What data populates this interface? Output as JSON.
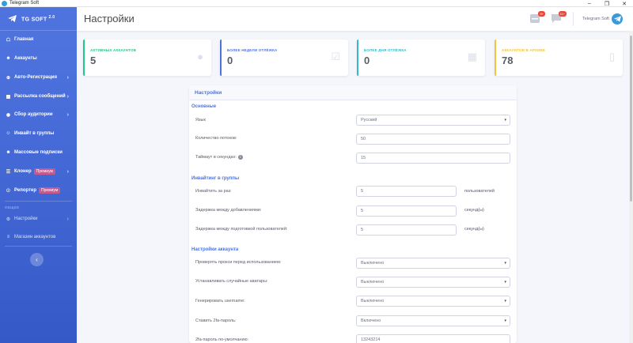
{
  "window": {
    "title": "Telegram Soft"
  },
  "brand": {
    "name": "TG SOFT",
    "version": "2.0"
  },
  "sidebar": {
    "items": [
      {
        "label": "Главная",
        "icon": "home-icon"
      },
      {
        "label": "Аккаунты",
        "icon": "users-icon"
      },
      {
        "label": "Авто-Регистрация",
        "icon": "plus-circle-icon",
        "has_submenu": true
      },
      {
        "label": "Рассылка сообщений",
        "icon": "comment-icon",
        "has_submenu": true
      },
      {
        "label": "Сбор аудитории",
        "icon": "collect-icon",
        "has_submenu": true
      },
      {
        "label": "Инвайт в группы",
        "icon": "group-icon"
      },
      {
        "label": "Массовые подписки",
        "icon": "user-plus-icon"
      },
      {
        "label": "Клонер",
        "icon": "sitemap-icon",
        "badge": "Премиум",
        "has_submenu": true
      },
      {
        "label": "Репортер",
        "icon": "dot-circle-icon",
        "badge": "Премиум"
      }
    ],
    "heading": "ОБЩЕЕ",
    "extra_items": [
      {
        "label": "Настройки",
        "icon": "gear-icon",
        "has_submenu": true
      },
      {
        "label": "Магазин аккаунтов",
        "icon": "shop-icon"
      }
    ]
  },
  "topbar": {
    "title": "Настройки",
    "notif_badge": "9+",
    "msg_badge": "11+",
    "user_name": "Telegram Soft"
  },
  "stats": [
    {
      "label": "Активных аккаунтов",
      "value": "5",
      "color": "#1cc88a",
      "icon": "user-icon"
    },
    {
      "label": "Более недели отлёжка",
      "value": "0",
      "color": "#4e73df",
      "icon": "calendar-check-icon"
    },
    {
      "label": "Более дня отлёжка",
      "value": "0",
      "color": "#36b9cc",
      "icon": "calendar-icon"
    },
    {
      "label": "Аккаунтов в архиве",
      "value": "78",
      "color": "#f6c23e",
      "icon": "file-icon"
    }
  ],
  "settings": {
    "card_title": "Настройки",
    "sections": {
      "basic": "Основные",
      "invite": "Инвайтинг в группы",
      "account": "Настройки аккаунта"
    },
    "fields": {
      "language": {
        "label": "Язык",
        "value": "Русский"
      },
      "threads": {
        "label": "Количество потоков:",
        "value": "50"
      },
      "timeout": {
        "label": "Таймаут в секундах:",
        "value": "15"
      },
      "invite_per": {
        "label": "Инвайтить за раз:",
        "value": "5",
        "unit": "пользователей"
      },
      "delay_add": {
        "label": "Задержка между добавлениями:",
        "value": "5",
        "unit": "секунд(ы)"
      },
      "delay_prep": {
        "label": "Задержка между подготовкой пользователей:",
        "value": "5",
        "unit": "секунд(ы)"
      },
      "check_proxy": {
        "label": "Проверять прокси перед использованием:",
        "value": "Выключено"
      },
      "random_avatar": {
        "label": "Устанавливать случайные аватары:",
        "value": "Выключено"
      },
      "gen_username": {
        "label": "Генерировать username:",
        "value": "Выключено"
      },
      "set_2fa": {
        "label": "Ставить 2fa-пароль:",
        "value": "Включено"
      },
      "default_2fa": {
        "label": "2fa-пароль по-умолчанию:",
        "value": "13243214"
      }
    }
  }
}
